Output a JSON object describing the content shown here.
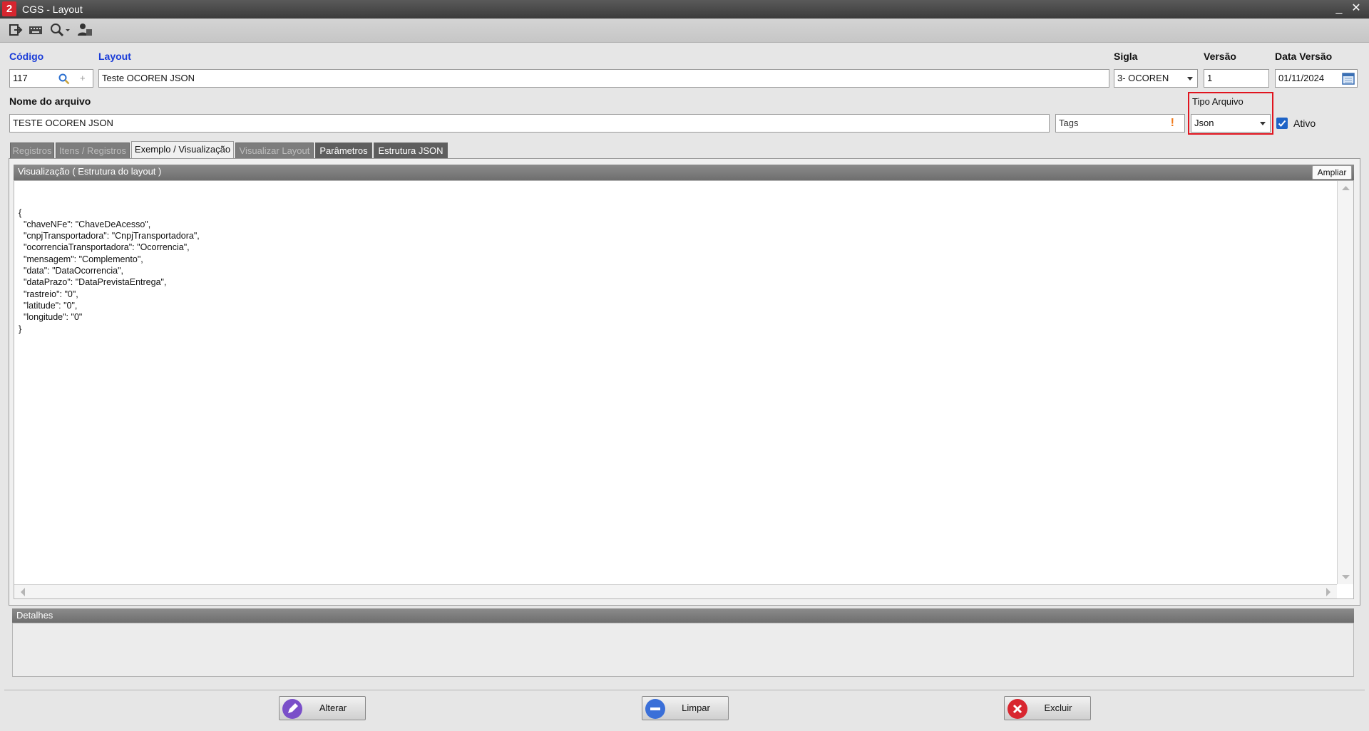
{
  "window": {
    "title": "CGS - Layout",
    "logo_glyph": "2",
    "minimize_glyph": "_",
    "close_glyph": "✕"
  },
  "toolbar": {
    "icons": [
      "exit-icon",
      "keyboard-icon",
      "search-icon",
      "user-icon"
    ]
  },
  "form": {
    "codigo": {
      "label": "Código",
      "value": "117"
    },
    "layout": {
      "label": "Layout",
      "value": "Teste OCOREN JSON"
    },
    "sigla": {
      "label": "Sigla",
      "value": "3- OCOREN"
    },
    "versao": {
      "label": "Versão",
      "value": "1"
    },
    "data_versao": {
      "label": "Data Versão",
      "value": "01/11/2024"
    },
    "nome_arquivo": {
      "label": "Nome do arquivo",
      "value": "TESTE OCOREN JSON"
    },
    "tags": {
      "value": "Tags",
      "alert_glyph": "!"
    },
    "tipo_arquivo": {
      "label": "Tipo Arquivo",
      "value": "Json"
    },
    "ativo": {
      "label": "Ativo",
      "checked": true
    }
  },
  "tabs": [
    {
      "label": "Registros",
      "state": "disabled"
    },
    {
      "label": "Itens / Registros",
      "state": "disabled"
    },
    {
      "label": "Exemplo / Visualização",
      "state": "active"
    },
    {
      "label": "Visualizar Layout",
      "state": "disabled"
    },
    {
      "label": "Parâmetros",
      "state": "enabled"
    },
    {
      "label": "Estrutura JSON",
      "state": "enabled"
    }
  ],
  "preview": {
    "header": "Visualização ( Estrutura do layout )",
    "ampliar_label": "Ampliar",
    "content": "{\n  \"chaveNFe\": \"ChaveDeAcesso\",\n  \"cnpjTransportadora\": \"CnpjTransportadora\",\n  \"ocorrenciaTransportadora\": \"Ocorrencia\",\n  \"mensagem\": \"Complemento\",\n  \"data\": \"DataOcorrencia\",\n  \"dataPrazo\": \"DataPrevistaEntrega\",\n  \"rastreio\": \"0\",\n  \"latitude\": \"0\",\n  \"longitude\": \"0\"\n}"
  },
  "detalhes": {
    "header": "Detalhes"
  },
  "actions": {
    "alterar": {
      "label": "Alterar",
      "color": "#7a4fc9"
    },
    "limpar": {
      "label": "Limpar",
      "color": "#3a6fd8"
    },
    "excluir": {
      "label": "Excluir",
      "color": "#d8262f"
    }
  },
  "colors": {
    "label_blue": "#1a3cd8",
    "highlight_red": "#e0141e",
    "checkbox_blue": "#1e63c6"
  }
}
